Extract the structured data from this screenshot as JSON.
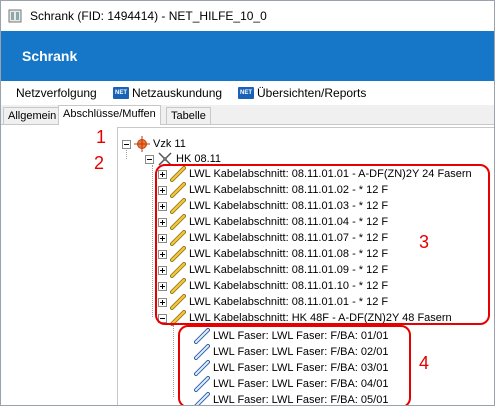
{
  "window": {
    "title": "Schrank (FID: 1494414) - NET_HILFE_10_0"
  },
  "header": {
    "title": "Schrank"
  },
  "menu": {
    "items": [
      "Netzverfolgung",
      "Netzauskundung",
      "Übersichten/Reports"
    ],
    "badge": "NET"
  },
  "tabs": [
    "Allgemein",
    "Abschlüsse/Muffen",
    "Tabelle"
  ],
  "tree": {
    "root": "Vzk 11",
    "child": "HK 08.11",
    "sections": [
      "LWL Kabelabschnitt: 08.11.01.01 - A-DF(ZN)2Y 24 Fasern",
      "LWL Kabelabschnitt: 08.11.01.02 - * 12 F",
      "LWL Kabelabschnitt: 08.11.01.03 - * 12 F",
      "LWL Kabelabschnitt: 08.11.01.04 - * 12 F",
      "LWL Kabelabschnitt: 08.11.01.07 - * 12 F",
      "LWL Kabelabschnitt: 08.11.01.08 - * 12 F",
      "LWL Kabelabschnitt: 08.11.01.09 - * 12 F",
      "LWL Kabelabschnitt: 08.11.01.10 - * 12 F",
      "LWL Kabelabschnitt: 08.11.01.01 - * 12 F",
      "LWL Kabelabschnitt: HK 48F - A-DF(ZN)2Y 48 Fasern"
    ],
    "fibers": [
      "LWL Faser: LWL Faser: F/BA: 01/01",
      "LWL Faser: LWL Faser: F/BA: 02/01",
      "LWL Faser: LWL Faser: F/BA: 03/01",
      "LWL Faser: LWL Faser: F/BA: 04/01",
      "LWL Faser: LWL Faser: F/BA: 05/01"
    ]
  },
  "annotations": [
    "1",
    "2",
    "3",
    "4"
  ],
  "colors": {
    "header": "#1677c9",
    "annotation": "#e60000",
    "net_badge": "#1a62b8"
  }
}
